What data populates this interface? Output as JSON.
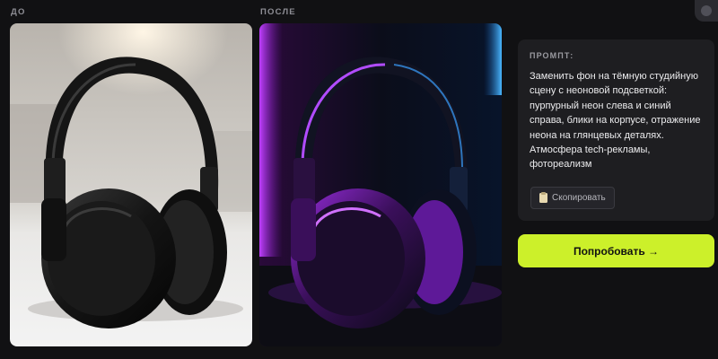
{
  "labels": {
    "before": "ДО",
    "after": "ПОСЛЕ"
  },
  "prompt": {
    "title": "ПРОМПТ:",
    "text": "Заменить фон на тёмную студийную сцену с неоновой подсветкой: пурпурный неон слева и синий справа, блики на корпусе, отражение неона на глянцевых деталях. Атмосфера tech-рекламы, фотореализм",
    "copy_label": "Скопировать",
    "copy_icon": "clipboard-icon"
  },
  "actions": {
    "try_label": "Попробовать →"
  },
  "colors": {
    "background": "#111113",
    "accent": "#ccf02a",
    "card": "#1e1e21",
    "neon_purple": "#a020f0",
    "neon_blue": "#3aa0ff"
  }
}
